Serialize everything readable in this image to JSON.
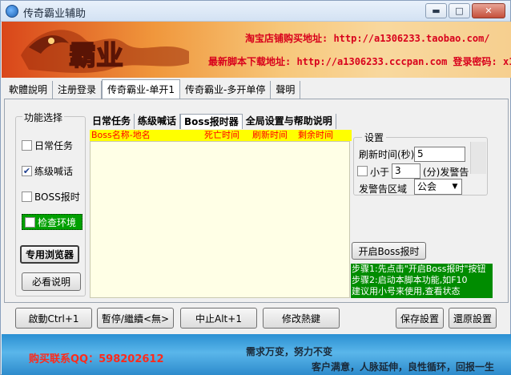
{
  "window": {
    "title": "传奇霸业辅助"
  },
  "banner": {
    "logo_text": "霸业",
    "line1": "淘宝店铺购买地址: http://a1306233.taobao.com/",
    "line2": "最新脚本下载地址: http://a1306233.cccpan.com 登录密码: x1"
  },
  "outer_tabs": [
    "軟體說明",
    "注册登录",
    "传奇霸业-单开1",
    "传奇霸业-多开单停",
    "聲明"
  ],
  "func_group": {
    "legend": "功能选择",
    "checks": [
      {
        "label": "日常任务",
        "checked": false
      },
      {
        "label": "练级喊话",
        "checked": true
      },
      {
        "label": "BOSS报时",
        "checked": false
      },
      {
        "label": "检查环境",
        "checked": false
      }
    ],
    "btn_browser": "专用浏览器",
    "btn_readme": "必看说明"
  },
  "inner_tabs": [
    "日常任务",
    "练级喊话",
    "Boss报时器",
    "全局设置与帮助说明"
  ],
  "boss_table": {
    "columns": [
      "Boss名称-地名",
      "死亡时间",
      "刷新时间",
      "剩余时间"
    ]
  },
  "settings": {
    "legend": "设置",
    "refresh_label": "刷新时间(秒)",
    "refresh_value": "5",
    "lessthan_label": "小于",
    "lessthan_value": "3",
    "lessthan_suffix": "(分)发警告",
    "zone_label": "发警告区域",
    "zone_value": "公会"
  },
  "start_boss_btn": "开启Boss报时",
  "help_lines": [
    "步骤1:先点击\"开启Boss报时\"按钮",
    "步骤2:启动本脚本功能,如F10",
    "建议用小号来使用,查看状态"
  ],
  "bottom_buttons": {
    "start": "啟動Ctrl+1",
    "pause": "暫停/繼續<無>",
    "stop": "中止Alt+1",
    "hotkey": "修改熱鍵",
    "save": "保存設置",
    "restore": "還原設置"
  },
  "footer": {
    "qq": "购买联系QQ：598202612",
    "slogan1": "需求万变，努力不变",
    "slogan2": "客户满意，人脉延伸，良性循环，回报一生"
  }
}
